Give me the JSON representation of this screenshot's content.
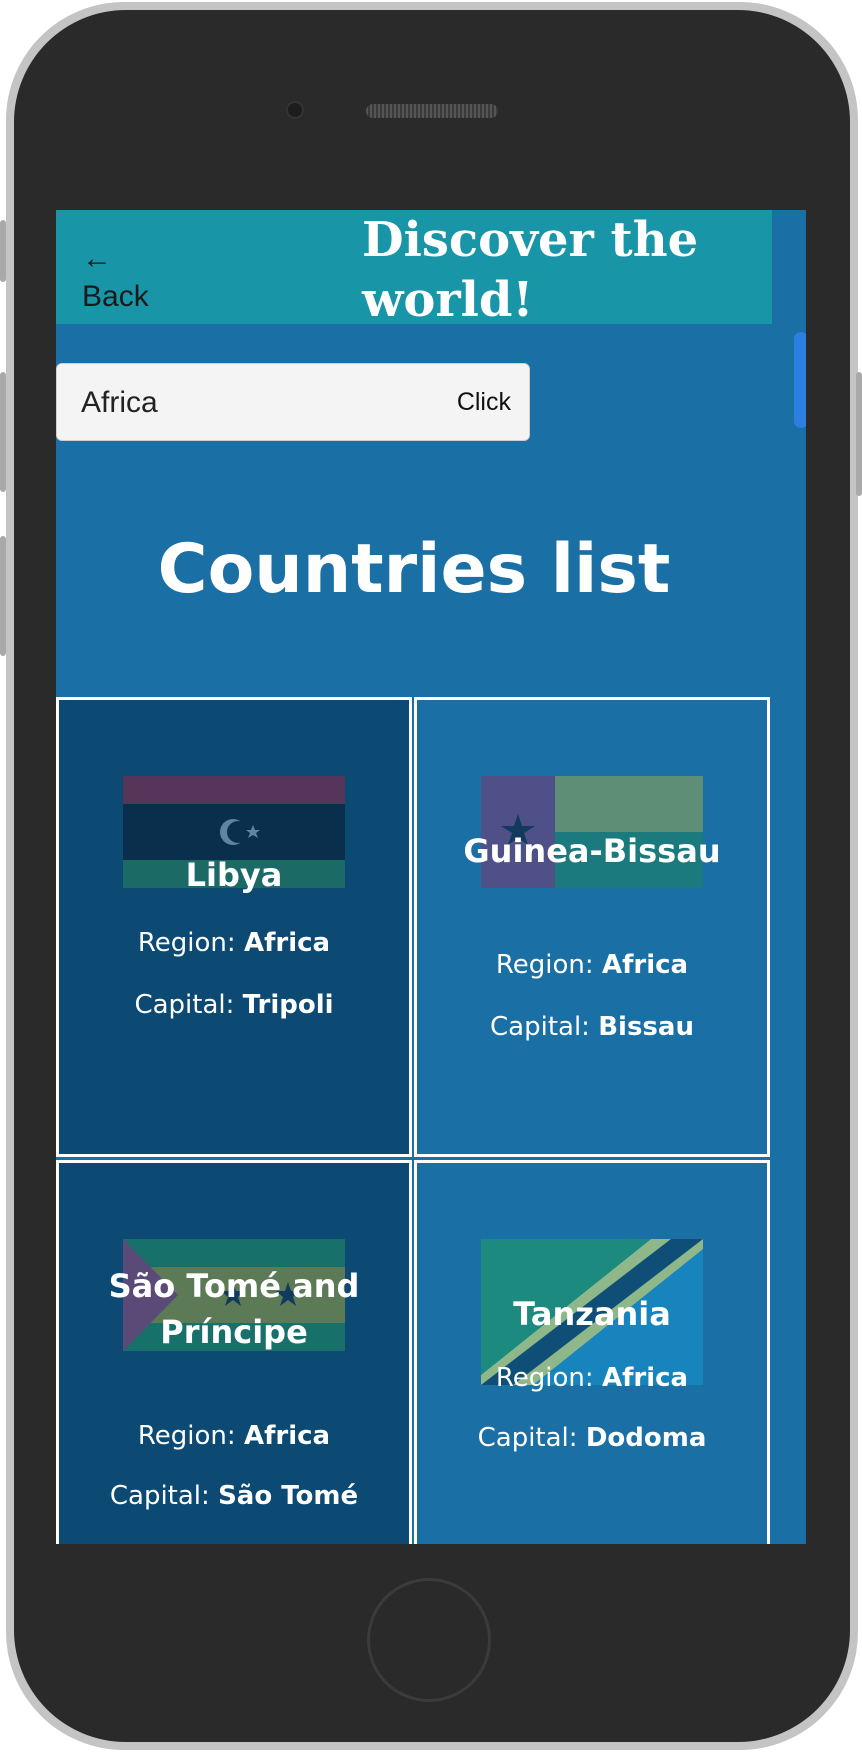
{
  "header": {
    "back_arrow": "←",
    "back_label": "Back",
    "title": "Discover the world!"
  },
  "search": {
    "value": "Africa",
    "button_label": "Click"
  },
  "list": {
    "title": "Countries list",
    "region_label": "Region:",
    "capital_label": "Capital:"
  },
  "countries": [
    {
      "name": "Libya",
      "region": "Africa",
      "capital": "Tripoli",
      "flag": "libya-flag"
    },
    {
      "name": "Guinea-Bissau",
      "region": "Africa",
      "capital": "Bissau",
      "flag": "guinea-bissau-flag"
    },
    {
      "name": "São Tomé and Príncipe",
      "region": "Africa",
      "capital": "São Tomé",
      "flag": "sao-tome-flag"
    },
    {
      "name": "Tanzania",
      "region": "Africa",
      "capital": "Dodoma",
      "flag": "tanzania-flag"
    }
  ],
  "colors": {
    "background": "#1a6fa5",
    "header": "#1995a8",
    "card_dark": "#0c4a73",
    "card_light": "#1a6fa5"
  }
}
